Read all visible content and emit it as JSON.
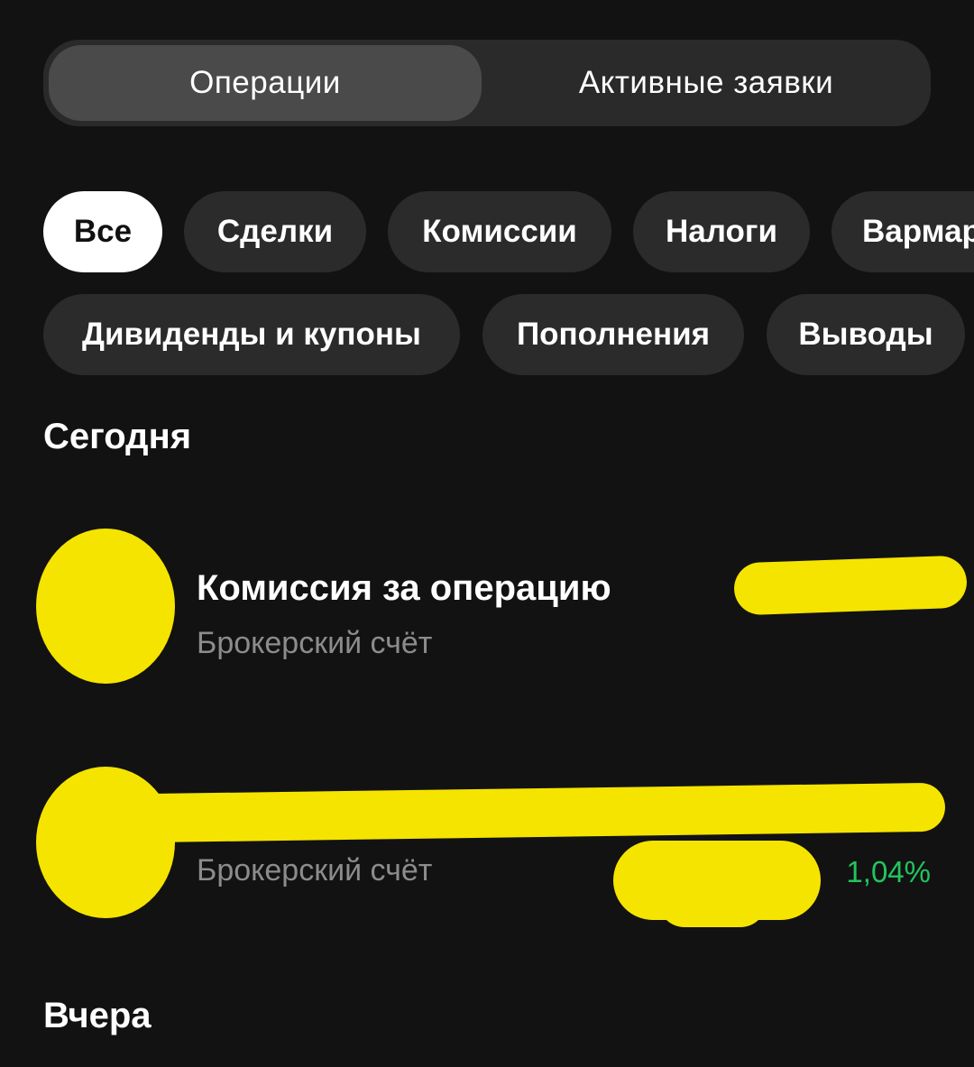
{
  "tabs": {
    "operations": "Операции",
    "active_orders": "Активные заявки"
  },
  "filters": {
    "all": "Все",
    "deals": "Сделки",
    "commissions": "Комиссии",
    "taxes": "Налоги",
    "varmargin": "Вармар",
    "dividends": "Дивиденды и купоны",
    "deposits": "Пополнения",
    "withdrawals": "Выводы"
  },
  "sections": {
    "today": "Сегодня",
    "yesterday": "Вчера"
  },
  "operations": [
    {
      "title": "Комиссия за операцию",
      "account": "Брокерский счёт"
    },
    {
      "account": "Брокерский счёт",
      "percent": "1,04%"
    }
  ],
  "colors": {
    "background": "#121212",
    "chip": "#2b2b2b",
    "redaction": "#f5e400",
    "positive": "#22c55e"
  }
}
